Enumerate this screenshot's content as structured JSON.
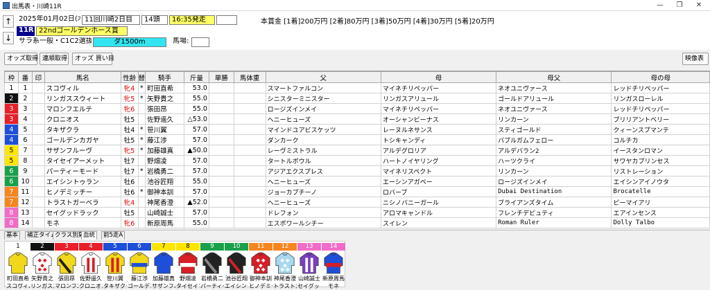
{
  "window": {
    "title": "出馬表・川崎11R",
    "minimize": "—",
    "restore": "❐",
    "close": "✕"
  },
  "header": {
    "date": "2025年01月02日(木)",
    "meeting": "11回川崎2日目",
    "heads": "14頭",
    "post_time": "16:35発走",
    "race_no": "11R",
    "race_name": "22ndゴールデンホース賞",
    "race_class": "サラ系一般・C1C2選抜",
    "distance": "ダ1500m",
    "baba_label": "馬場:",
    "prize": "本賞金 [1着]200万円 [2着]80万円 [3着]50万円 [4着]30万円 [5着]20万円",
    "up_arrow": "↑",
    "down_arrow": "↓"
  },
  "toolbar": {
    "odds": "オッズ取得",
    "renpuku": "連順取得",
    "odds_buy": "オッズ 買い目",
    "video": "映像表"
  },
  "columns": [
    "枠",
    "番",
    "印",
    "馬名",
    "性齢",
    "替",
    "騎手",
    "斤量",
    "単勝",
    "馬体重",
    "父",
    "母",
    "母父",
    "母の母"
  ],
  "gate_colors": {
    "1": "#ffffff",
    "2": "#111111",
    "3": "#e8202a",
    "4": "#1f4fd8",
    "5": "#ffe600",
    "6": "#19a04a",
    "7": "#f5861f",
    "8": "#f06cc8"
  },
  "rows": [
    {
      "waku": "1",
      "num": "1",
      "mark": "",
      "name": "スコヴィル",
      "sex": "牝4",
      "change": "*",
      "jockey": "町田直希",
      "weight": "53.0",
      "odds": "",
      "body": "",
      "sire": "スマートファルコン",
      "dam": "マイネチリペッパー",
      "damsire": "ネオユニヴァース",
      "damdam": "レッドチリペッパー"
    },
    {
      "waku": "2",
      "num": "2",
      "mark": "",
      "name": "リンガススウィート",
      "sex": "牝5",
      "change": "*",
      "jockey": "矢野貴之",
      "weight": "55.0",
      "odds": "",
      "body": "",
      "sire": "シニスターミニスター",
      "dam": "リンガスアリュール",
      "damsire": "ゴールドアリュール",
      "damdam": "リンガスローレル"
    },
    {
      "waku": "3",
      "num": "3",
      "mark": "",
      "name": "マロンフエルテ",
      "sex": "牝6",
      "change": "",
      "jockey": "張田昂",
      "weight": "55.0",
      "odds": "",
      "body": "",
      "sire": "ロージズインメイ",
      "dam": "マイネチリペッパー",
      "damsire": "ネオユニヴァース",
      "damdam": "レッドチリペッパー"
    },
    {
      "waku": "3",
      "num": "4",
      "mark": "",
      "name": "クロニオス",
      "sex": "牡5",
      "change": "",
      "jockey": "佐野遥久",
      "weight": "△53.0",
      "odds": "",
      "body": "",
      "sire": "ヘニーヒューズ",
      "dam": "オーシャンビーナス",
      "damsire": "リンカーン",
      "damdam": "ブリリアントベリー"
    },
    {
      "waku": "4",
      "num": "5",
      "mark": "",
      "name": "タキザクラ",
      "sex": "牡4",
      "change": "*",
      "jockey": "笹川翼",
      "weight": "57.0",
      "odds": "",
      "body": "",
      "sire": "マインドユアビスケッツ",
      "dam": "レーヌルネサンス",
      "damsire": "スティゴールド",
      "damdam": "クィーンスプマンテ"
    },
    {
      "waku": "4",
      "num": "6",
      "mark": "",
      "name": "ゴールデンカガヤ",
      "sex": "牡5",
      "change": "*",
      "jockey": "藤江渉",
      "weight": "57.0",
      "odds": "",
      "body": "",
      "sire": "ダンカーク",
      "dam": "トシキャンディ",
      "damsire": "バブルガムフェロー",
      "damdam": "コルチカ"
    },
    {
      "waku": "5",
      "num": "7",
      "mark": "",
      "name": "サザンフルーヴ",
      "sex": "牝5",
      "change": "*",
      "jockey": "加藤雄真",
      "weight": "▲50.0",
      "odds": "",
      "body": "",
      "sire": "レーヴミストラル",
      "dam": "アルデグロリア",
      "damsire": "アルデバラン2",
      "damdam": "イースタンロマン"
    },
    {
      "waku": "5",
      "num": "8",
      "mark": "",
      "name": "タイセイアーメット",
      "sex": "牡7",
      "change": "",
      "jockey": "野畑凌",
      "weight": "57.0",
      "odds": "",
      "body": "",
      "sire": "タートルボウル",
      "dam": "ハートノイヤリング",
      "damsire": "ハーツクライ",
      "damdam": "サワヤカプリンセス"
    },
    {
      "waku": "6",
      "num": "9",
      "mark": "",
      "name": "パーティーモード",
      "sex": "牡7",
      "change": "*",
      "jockey": "岩橋勇二",
      "weight": "57.0",
      "odds": "",
      "body": "",
      "sire": "アジアエクスプレス",
      "dam": "マイネリスペクト",
      "damsire": "リンカーン",
      "damdam": "リストレーション"
    },
    {
      "waku": "6",
      "num": "10",
      "mark": "",
      "name": "エイシントゥラン",
      "sex": "牡6",
      "change": "",
      "jockey": "池谷匠翔",
      "weight": "55.0",
      "odds": "",
      "body": "",
      "sire": "ヘニーヒューズ",
      "dam": "エーシンアガペー",
      "damsire": "ロージズインメイ",
      "damdam": "エイシンアイノウタ"
    },
    {
      "waku": "7",
      "num": "11",
      "mark": "",
      "name": "ヒノデミッチー",
      "sex": "牡6",
      "change": "*",
      "jockey": "御神本訓",
      "weight": "57.0",
      "odds": "",
      "body": "",
      "sire": "ジョーカプチーノ",
      "dam": "ロバーブ",
      "damsire": "Dubai Destination",
      "damdam": "Brocatelle"
    },
    {
      "waku": "7",
      "num": "12",
      "mark": "",
      "name": "トラストガーベラ",
      "sex": "牝4",
      "change": "",
      "jockey": "神尾香澄",
      "weight": "▲52.0",
      "odds": "",
      "body": "",
      "sire": "ヘニーヒューズ",
      "dam": "ニシノバニーガール",
      "damsire": "ブライアンズタイム",
      "damdam": "ビーマイアリ"
    },
    {
      "waku": "8",
      "num": "13",
      "mark": "",
      "name": "セイグッドラック",
      "sex": "牡5",
      "change": "",
      "jockey": "山崎誠士",
      "weight": "57.0",
      "odds": "",
      "body": "",
      "sire": "ドレフォン",
      "dam": "アロマキャンドル",
      "damsire": "フレンチデピュティ",
      "damdam": "エアインセンス"
    },
    {
      "waku": "8",
      "num": "14",
      "mark": "",
      "name": "モネ",
      "sex": "牝6",
      "change": "",
      "jockey": "新原周馬",
      "weight": "55.0",
      "odds": "",
      "body": "",
      "sire": "エスポワールシチー",
      "dam": "スイレン",
      "damsire": "Roman Ruler",
      "damdam": "Dolly Talbo"
    }
  ],
  "tabs": [
    "基本",
    "補正タイム",
    "クラス別集",
    "血統",
    "前5走A"
  ],
  "silks": [
    {
      "num": "1",
      "jockey": "町田直希",
      "horse": "スコヴィル",
      "a": "#f2d81a",
      "b": "#d61f26",
      "p": "plain"
    },
    {
      "num": "2",
      "jockey": "矢野貴之",
      "horse": "リンガスス",
      "a": "#ffffff",
      "b": "#d61f26",
      "p": "diamond"
    },
    {
      "num": "3",
      "jockey": "張田昂",
      "horse": "マロンフエ",
      "a": "#f2d81a",
      "b": "#222222",
      "p": "sash"
    },
    {
      "num": "4",
      "jockey": "佐野遥久",
      "horse": "クロニオス",
      "a": "#ffffff",
      "b": "#d61f26",
      "p": "stripe"
    },
    {
      "num": "5",
      "jockey": "笹川翼",
      "horse": "タキザクラ",
      "a": "#f2d81a",
      "b": "#d61f26",
      "p": "stripe"
    },
    {
      "num": "6",
      "jockey": "藤江渉",
      "horse": "ゴールデン",
      "a": "#f2d81a",
      "b": "#1f4fd8",
      "p": "band"
    },
    {
      "num": "7",
      "jockey": "加藤雄真",
      "horse": "サザンフル",
      "a": "#1f4fd8",
      "b": "#ffffff",
      "p": "plain"
    },
    {
      "num": "8",
      "jockey": "野畑凌",
      "horse": "タイセイア",
      "a": "#d61f26",
      "b": "#ffffff",
      "p": "band"
    },
    {
      "num": "9",
      "jockey": "岩橋勇二",
      "horse": "パーティー",
      "a": "#222222",
      "b": "#888888",
      "p": "sash"
    },
    {
      "num": "10",
      "jockey": "池谷匠翔",
      "horse": "エイシント",
      "a": "#222222",
      "b": "#d61f26",
      "p": "sash"
    },
    {
      "num": "11",
      "jockey": "御神本訓",
      "horse": "ヒノデミッ",
      "a": "#d61f26",
      "b": "#ffffff",
      "p": "diamond"
    },
    {
      "num": "12",
      "jockey": "神尾香澄",
      "horse": "トラストガ",
      "a": "#a8d8f0",
      "b": "#ffffff",
      "p": "diamond"
    },
    {
      "num": "13",
      "jockey": "山崎誠士",
      "horse": "セイグッド",
      "a": "#7a3fc0",
      "b": "#ffffff",
      "p": "stripe"
    },
    {
      "num": "14",
      "jockey": "新原周馬",
      "horse": "モネ",
      "a": "#1f4fd8",
      "b": "#d61f26",
      "p": "band"
    }
  ],
  "silk_num_colors": [
    {
      "bg": "#ffffff",
      "fg": "#000000"
    },
    {
      "bg": "#111111",
      "fg": "#ffffff"
    },
    {
      "bg": "#e8202a",
      "fg": "#ffffff"
    },
    {
      "bg": "#e8202a",
      "fg": "#ffffff"
    },
    {
      "bg": "#1f4fd8",
      "fg": "#ffffff"
    },
    {
      "bg": "#1f4fd8",
      "fg": "#ffffff"
    },
    {
      "bg": "#ffe600",
      "fg": "#000000"
    },
    {
      "bg": "#ffe600",
      "fg": "#000000"
    },
    {
      "bg": "#19a04a",
      "fg": "#ffffff"
    },
    {
      "bg": "#19a04a",
      "fg": "#ffffff"
    },
    {
      "bg": "#f5861f",
      "fg": "#ffffff"
    },
    {
      "bg": "#f5861f",
      "fg": "#ffffff"
    },
    {
      "bg": "#f06cc8",
      "fg": "#ffffff"
    },
    {
      "bg": "#f06cc8",
      "fg": "#ffffff"
    }
  ]
}
